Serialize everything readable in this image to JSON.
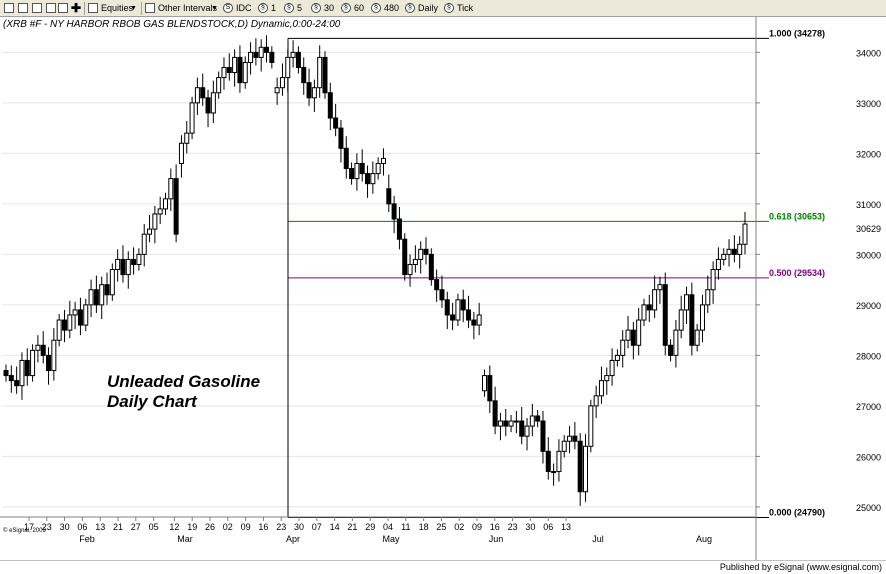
{
  "toolbar": {
    "equities_label": "Equities",
    "other_intervals_label": "Other Intervals",
    "intervals": [
      "IDC",
      "1",
      "5",
      "30",
      "60",
      "480",
      "Daily",
      "Tick"
    ]
  },
  "chart_data": {
    "type": "candlestick",
    "title": "(XRB #F - NY HARBOR RBOB GAS BLENDSTOCK,D) Dynamic,0:00-24:00",
    "annotation": "Unleaded Gasoline\nDaily Chart",
    "watermark": "© eSignal, 2009",
    "ylim": [
      24800,
      34700
    ],
    "y_ticks": [
      25000,
      26000,
      27000,
      28000,
      29000,
      30000,
      31000,
      32000,
      33000,
      34000
    ],
    "last_price": "30629",
    "x_day_labels": [
      "17",
      "23",
      "30",
      "06",
      "13",
      "21",
      "27",
      "05",
      "12",
      "19",
      "26",
      "02",
      "09",
      "16",
      "23",
      "30",
      "07",
      "14",
      "21",
      "29",
      "04",
      "11",
      "18",
      "25",
      "02",
      "09",
      "16",
      "23",
      "30",
      "06",
      "13"
    ],
    "x_month_labels": [
      "Feb",
      "Mar",
      "Apr",
      "May",
      "Jun",
      "Jul",
      "Aug"
    ],
    "fib_levels": [
      {
        "label": "1.000 (34278)",
        "value": 34278,
        "color": "#000000"
      },
      {
        "label": "0.618 (30653)",
        "value": 30653,
        "color": "#008000"
      },
      {
        "label": "0.500 (29534)",
        "value": 29534,
        "color": "#800080"
      },
      {
        "label": "0.000 (24790)",
        "value": 24790,
        "color": "#000000"
      }
    ],
    "closes": [
      27600,
      27500,
      27400,
      27900,
      27600,
      28100,
      28200,
      28000,
      27700,
      28300,
      28700,
      28500,
      28800,
      28900,
      28600,
      29000,
      29300,
      29000,
      29400,
      29200,
      29700,
      29900,
      29600,
      29900,
      29800,
      30000,
      30400,
      30500,
      30800,
      30900,
      31100,
      31500,
      30400,
      32200,
      32400,
      33000,
      33300,
      33100,
      32800,
      33200,
      33500,
      33700,
      33600,
      33900,
      33400,
      33800,
      34000,
      33900,
      34100,
      34000,
      33800,
      33300,
      33500,
      33900,
      34000,
      33700,
      33400,
      33100,
      33300,
      33900,
      33200,
      32700,
      32500,
      32100,
      31700,
      31500,
      31800,
      31600,
      31400,
      31600,
      31800,
      31900,
      31000,
      30700,
      30300,
      29600,
      29800,
      29900,
      30100,
      30000,
      29500,
      29300,
      29100,
      28800,
      28700,
      29100,
      28900,
      28700,
      28600,
      28800,
      27600,
      27100,
      26600,
      26700,
      26600,
      26700,
      26700,
      26400,
      26600,
      26800,
      26700,
      26100,
      25700,
      25700,
      26100,
      26300,
      26400,
      26300,
      25300,
      26200,
      27000,
      27200,
      27500,
      27600,
      27900,
      28000,
      28300,
      28500,
      28200,
      28700,
      29000,
      28900,
      29300,
      29400,
      28200,
      28000,
      28500,
      28900,
      29200,
      28200,
      28500,
      29000,
      29300,
      29700,
      29900,
      30000,
      30100,
      30000,
      30200,
      30600
    ],
    "opens": [
      27700,
      27600,
      27500,
      27400,
      27900,
      27600,
      28100,
      28200,
      28000,
      27700,
      28300,
      28700,
      28500,
      28800,
      28900,
      28600,
      29000,
      29300,
      29000,
      29400,
      29200,
      29700,
      29900,
      29600,
      29900,
      29800,
      30000,
      30400,
      30500,
      30800,
      30900,
      31100,
      31500,
      31800,
      32200,
      32400,
      33000,
      33300,
      33100,
      32800,
      33200,
      33500,
      33700,
      33600,
      33900,
      33400,
      33800,
      34000,
      33900,
      34100,
      34000,
      33200,
      33300,
      33500,
      33900,
      34000,
      33700,
      33400,
      33100,
      33300,
      33900,
      33200,
      32700,
      32500,
      32100,
      31700,
      31500,
      31800,
      31600,
      31400,
      31600,
      31800,
      31300,
      31000,
      30700,
      30300,
      29600,
      29800,
      29900,
      30100,
      30000,
      29500,
      29300,
      29100,
      28800,
      28700,
      29100,
      28900,
      28700,
      28600,
      27300,
      27600,
      27100,
      26600,
      26700,
      26600,
      26700,
      26700,
      26400,
      26600,
      26800,
      26700,
      26100,
      25700,
      25700,
      26100,
      26300,
      26400,
      26300,
      25300,
      26200,
      27000,
      27200,
      27500,
      27600,
      27900,
      28000,
      28300,
      28500,
      28200,
      28700,
      29000,
      28900,
      29300,
      29400,
      28200,
      28000,
      28500,
      28900,
      29200,
      28200,
      28500,
      29000,
      29300,
      29700,
      29900,
      30000,
      30100,
      30000,
      30200
    ]
  }
}
